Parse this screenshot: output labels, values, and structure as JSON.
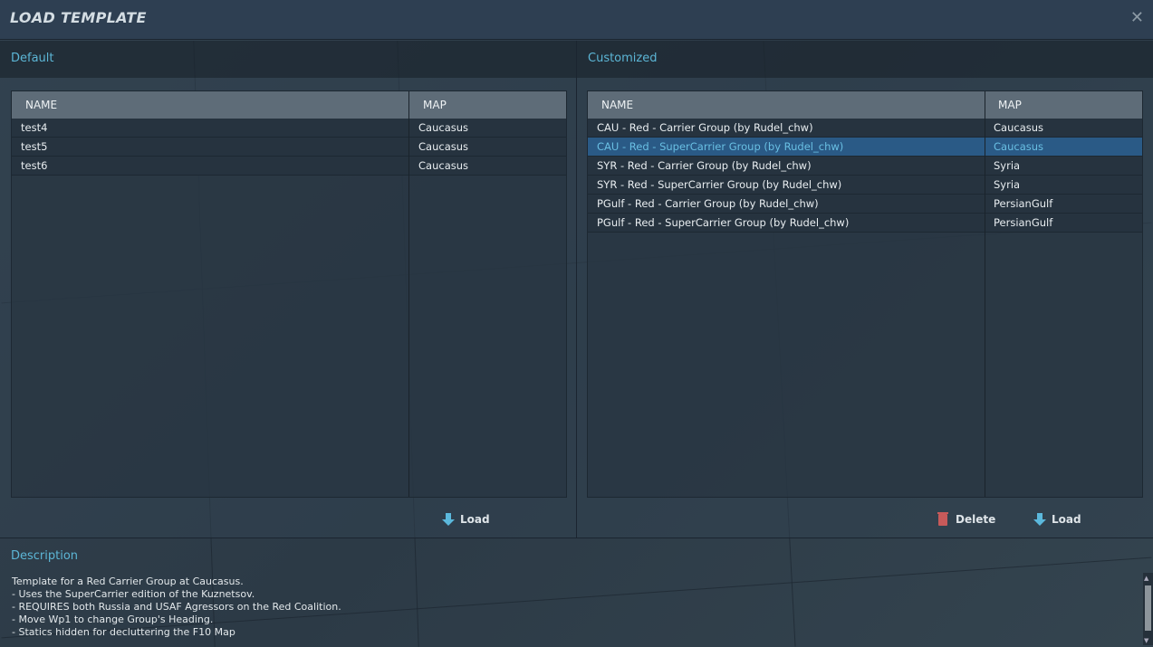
{
  "window": {
    "title": "LOAD TEMPLATE",
    "close_icon": "close-icon"
  },
  "default": {
    "label": "Default",
    "columns": [
      "NAME",
      "MAP"
    ],
    "rows": [
      {
        "name": "test4",
        "map": "Caucasus"
      },
      {
        "name": "test5",
        "map": "Caucasus"
      },
      {
        "name": "test6",
        "map": "Caucasus"
      }
    ],
    "load_label": "Load"
  },
  "customized": {
    "label": "Customized",
    "columns": [
      "NAME",
      "MAP"
    ],
    "rows": [
      {
        "name": "CAU - Red - Carrier Group (by Rudel_chw)",
        "map": "Caucasus"
      },
      {
        "name": "CAU - Red - SuperCarrier Group (by Rudel_chw)",
        "map": "Caucasus",
        "selected": true
      },
      {
        "name": "SYR - Red - Carrier Group (by Rudel_chw)",
        "map": "Syria"
      },
      {
        "name": "SYR - Red - SuperCarrier Group (by Rudel_chw)",
        "map": "Syria"
      },
      {
        "name": "PGulf - Red - Carrier Group (by Rudel_chw)",
        "map": "PersianGulf"
      },
      {
        "name": "PGulf - Red - SuperCarrier Group (by Rudel_chw)",
        "map": "PersianGulf"
      }
    ],
    "delete_label": "Delete",
    "load_label": "Load"
  },
  "description": {
    "label": "Description",
    "text": "Template for a Red Carrier Group at Caucasus.\n- Uses the SuperCarrier edition of the Kuznetsov.\n- REQUIRES both Russia and USAF Agressors on the Red Coalition.\n- Move Wp1 to change Group's Heading.\n- Statics hidden for decluttering the F10 Map"
  },
  "colors": {
    "accent": "#5cb6d6",
    "selected_row": "#2a5a86",
    "delete": "#c75a5a"
  }
}
